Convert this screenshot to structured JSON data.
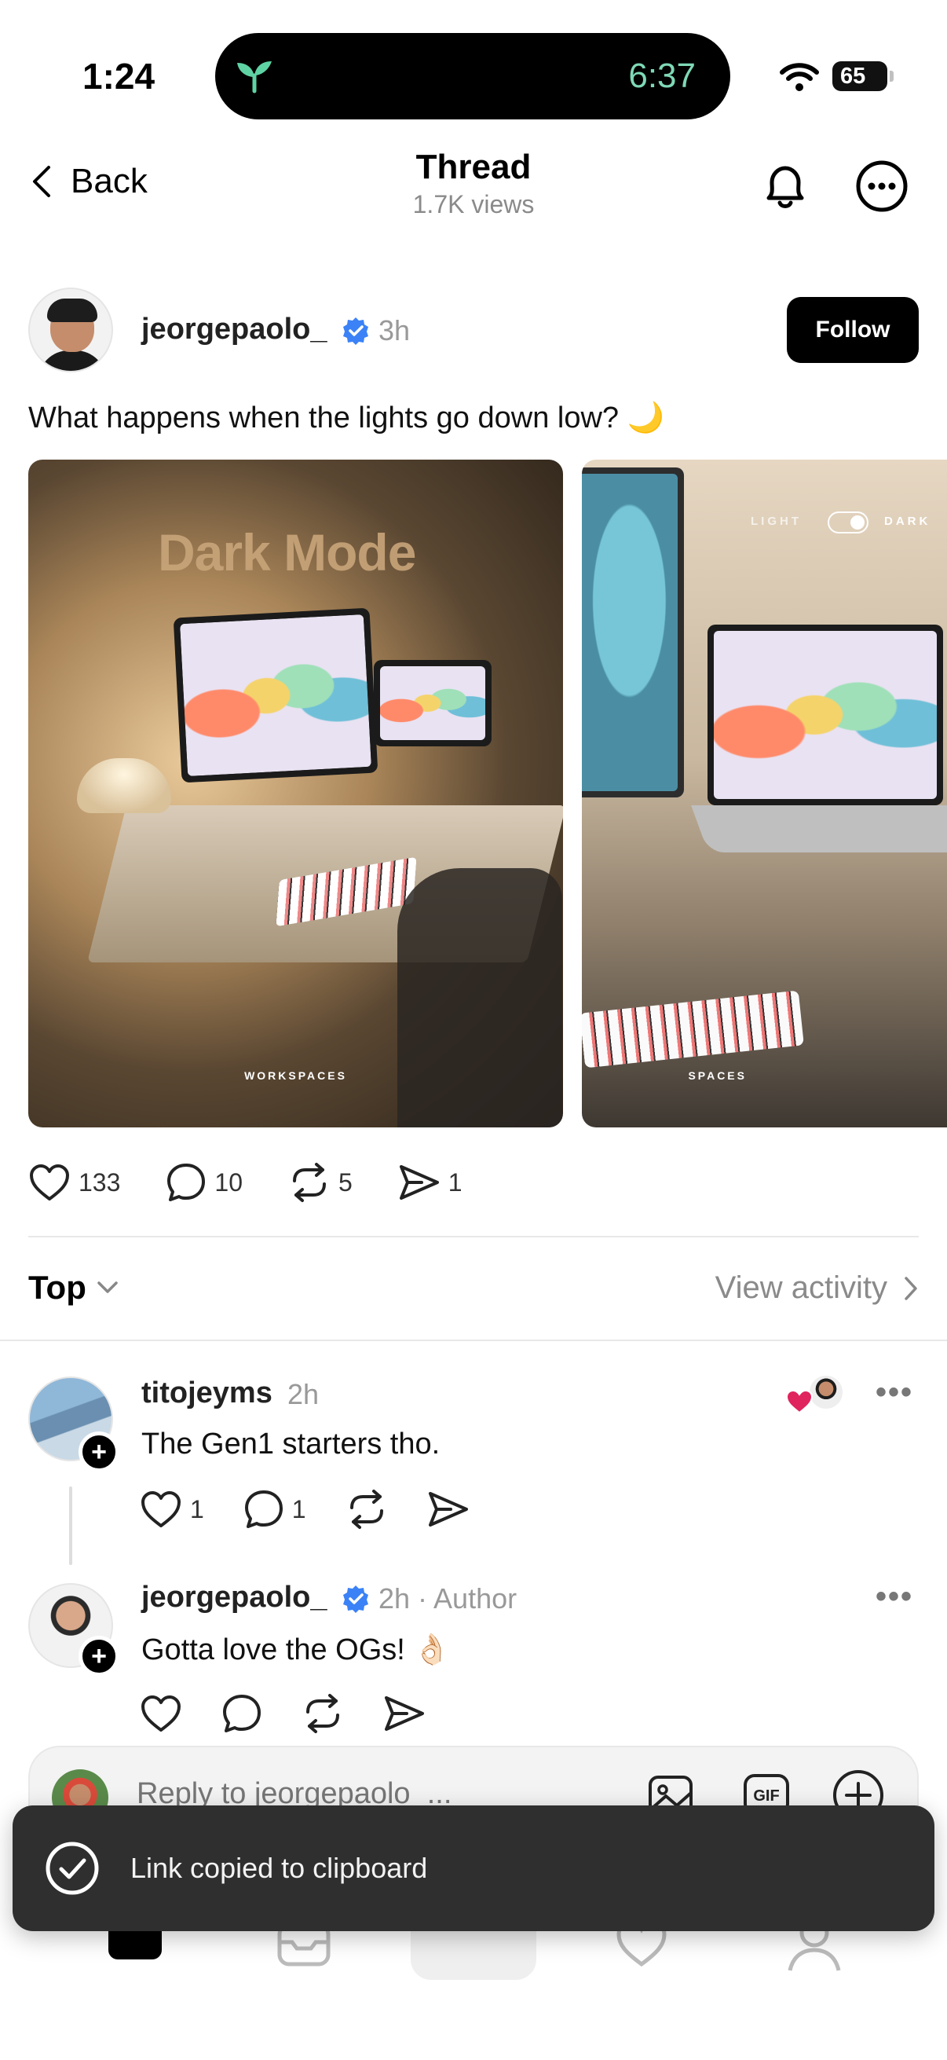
{
  "status_bar": {
    "time": "1:24",
    "live_activity_time": "6:37",
    "battery": "65"
  },
  "header": {
    "back_label": "Back",
    "title": "Thread",
    "views": "1.7K views"
  },
  "post": {
    "username": "jeorgepaolo_",
    "time": "3h",
    "follow_label": "Follow",
    "text": "What happens when the lights go down low? 🌙",
    "images": [
      {
        "title": "Dark Mode",
        "caption": "WORKSPACES"
      },
      {
        "toggle_left": "LIGHT",
        "toggle_right": "DARK",
        "caption": "SPACES"
      }
    ],
    "actions": {
      "likes": "133",
      "comments": "10",
      "reposts": "5",
      "shares": "1"
    }
  },
  "sort": {
    "label": "Top",
    "view_activity": "View activity"
  },
  "replies": [
    {
      "username": "titojeyms",
      "time": "2h",
      "text": "The Gen1 starters tho.",
      "likes": "1",
      "comments": "1"
    },
    {
      "username": "jeorgepaolo_",
      "time": "2h · Author",
      "text": "Gotta love the OGs! 👌🏻"
    }
  ],
  "composer": {
    "placeholder": "Reply to jeorgepaolo_..."
  },
  "toast": {
    "text": "Link copied to clipboard"
  },
  "colors": {
    "verified": "#3b82f6",
    "heart": "#e0245e",
    "toast_bg": "#2f2f2f",
    "island_text": "#7fd9b6"
  }
}
